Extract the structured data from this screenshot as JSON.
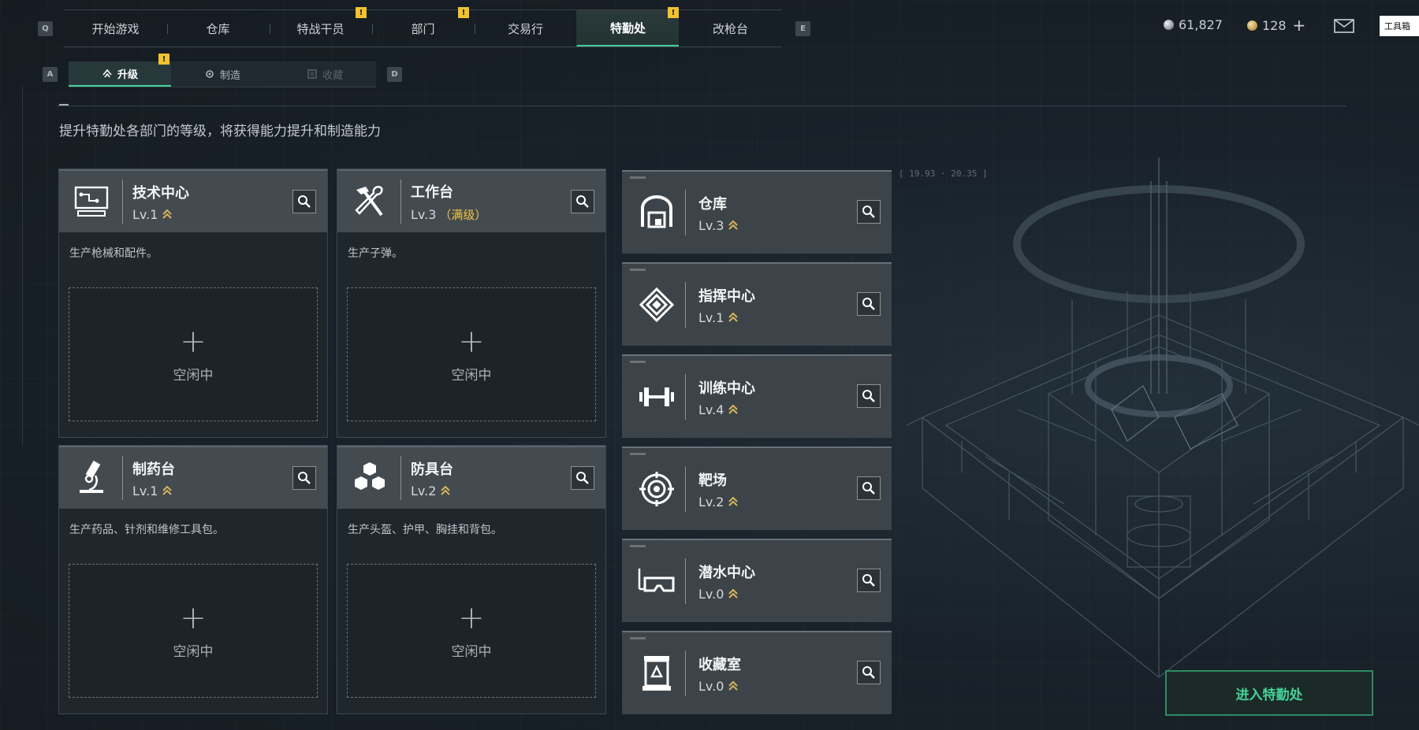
{
  "top_nav": {
    "left_key": "Q",
    "right_key": "E",
    "tabs": [
      {
        "label": "开始游戏",
        "alert": false
      },
      {
        "label": "仓库",
        "alert": false
      },
      {
        "label": "特战干员",
        "alert": true
      },
      {
        "label": "部门",
        "alert": true
      },
      {
        "label": "交易行",
        "alert": false
      },
      {
        "label": "特勤处",
        "alert": true,
        "active": true
      },
      {
        "label": "改枪台",
        "alert": false
      }
    ],
    "alert_symbol": "!"
  },
  "currency": {
    "silver": "61,827",
    "gold": "128",
    "add": "+"
  },
  "tool_box_label": "工具箱",
  "sub_nav": {
    "left_key": "A",
    "right_key": "D",
    "tabs": [
      {
        "label": "升级",
        "icon": "upgrade-icon",
        "active": true,
        "alert": true
      },
      {
        "label": "制造",
        "icon": "craft-icon"
      },
      {
        "label": "收藏",
        "icon": "collection-icon",
        "disabled": true
      }
    ]
  },
  "subtitle": "提升特勤处各部门的等级，将获得能力提升和制造能力",
  "facilities": [
    {
      "name": "技术中心",
      "level": "Lv.1",
      "max_label": "",
      "icon": "computer-icon",
      "desc": "生产枪械和配件。",
      "slot_label": "空闲中",
      "slot_plus": "+"
    },
    {
      "name": "工作台",
      "level": "Lv.3",
      "max_label": "（满级）",
      "icon": "tools-icon",
      "desc": "生产子弹。",
      "slot_label": "空闲中",
      "slot_plus": "+"
    },
    {
      "name": "制药台",
      "level": "Lv.1",
      "max_label": "",
      "icon": "microscope-icon",
      "desc": "生产药品、针剂和维修工具包。",
      "slot_label": "空闲中",
      "slot_plus": "+"
    },
    {
      "name": "防具台",
      "level": "Lv.2",
      "max_label": "",
      "icon": "cubes-icon",
      "desc": "生产头盔、护甲、胸挂和背包。",
      "slot_label": "空闲中",
      "slot_plus": "+"
    }
  ],
  "departments": [
    {
      "name": "仓库",
      "level": "Lv.3",
      "icon": "warehouse-icon"
    },
    {
      "name": "指挥中心",
      "level": "Lv.1",
      "icon": "command-icon"
    },
    {
      "name": "训练中心",
      "level": "Lv.4",
      "icon": "dumbbell-icon"
    },
    {
      "name": "靶场",
      "level": "Lv.2",
      "icon": "target-icon"
    },
    {
      "name": "潜水中心",
      "level": "Lv.0",
      "icon": "diving-mask-icon"
    },
    {
      "name": "收藏室",
      "level": "Lv.0",
      "icon": "collection-room-icon"
    }
  ],
  "art_coords": "[ 19.93 · 20.35 ]",
  "enter_button": "进入特勤处",
  "colors": {
    "accent": "#47d19a",
    "alert": "#f2c230",
    "max_level": "#f0c542"
  }
}
